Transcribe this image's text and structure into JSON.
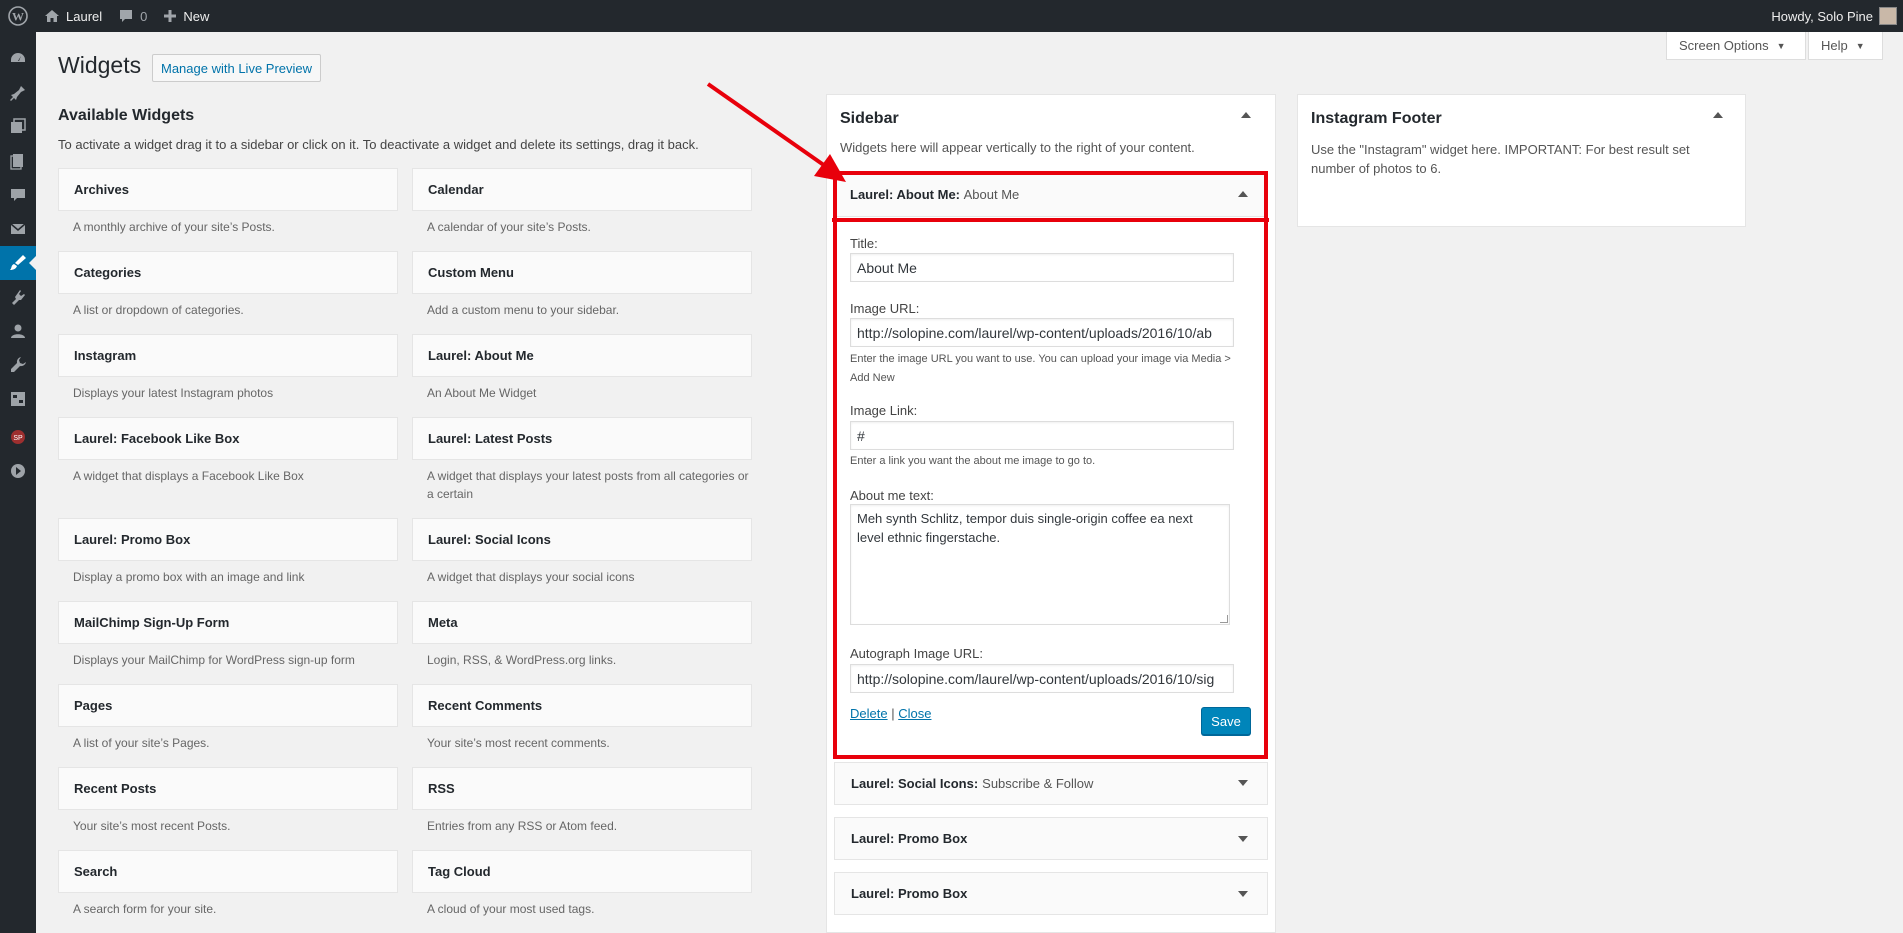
{
  "adminbar": {
    "site_name": "Laurel",
    "comments_count": "0",
    "new_label": "New",
    "howdy": "Howdy, Solo Pine"
  },
  "header": {
    "title": "Widgets",
    "live_preview": "Manage with Live Preview",
    "screen_options": "Screen Options",
    "help": "Help"
  },
  "available": {
    "title": "Available Widgets",
    "description": "To activate a widget drag it to a sidebar or click on it. To deactivate a widget and delete its settings, drag it back.",
    "widgets": [
      {
        "name": "Archives",
        "desc": "A monthly archive of your site’s Posts."
      },
      {
        "name": "Calendar",
        "desc": "A calendar of your site’s Posts."
      },
      {
        "name": "Categories",
        "desc": "A list or dropdown of categories."
      },
      {
        "name": "Custom Menu",
        "desc": "Add a custom menu to your sidebar."
      },
      {
        "name": "Instagram",
        "desc": "Displays your latest Instagram photos"
      },
      {
        "name": "Laurel: About Me",
        "desc": "An About Me Widget"
      },
      {
        "name": "Laurel: Facebook Like Box",
        "desc": "A widget that displays a Facebook Like Box"
      },
      {
        "name": "Laurel: Latest Posts",
        "desc": "A widget that displays your latest posts from all categories or a certain"
      },
      {
        "name": "Laurel: Promo Box",
        "desc": "Display a promo box with an image and link"
      },
      {
        "name": "Laurel: Social Icons",
        "desc": "A widget that displays your social icons"
      },
      {
        "name": "MailChimp Sign-Up Form",
        "desc": "Displays your MailChimp for WordPress sign-up form"
      },
      {
        "name": "Meta",
        "desc": "Login, RSS, & WordPress.org links."
      },
      {
        "name": "Pages",
        "desc": "A list of your site’s Pages."
      },
      {
        "name": "Recent Comments",
        "desc": "Your site’s most recent comments."
      },
      {
        "name": "Recent Posts",
        "desc": "Your site’s most recent Posts."
      },
      {
        "name": "RSS",
        "desc": "Entries from any RSS or Atom feed."
      },
      {
        "name": "Search",
        "desc": "A search form for your site."
      },
      {
        "name": "Tag Cloud",
        "desc": "A cloud of your most used tags."
      }
    ]
  },
  "sidebar": {
    "title": "Sidebar",
    "description": "Widgets here will appear vertically to the right of your content.",
    "open_widget": {
      "type": "Laurel: About Me:",
      "instance": "About Me",
      "title_label": "Title:",
      "title_value": "About Me",
      "image_url_label": "Image URL:",
      "image_url_value": "http://solopine.com/laurel/wp-content/uploads/2016/10/ab",
      "image_url_help": "Enter the image URL you want to use. You can upload your image via Media > Add New",
      "image_link_label": "Image Link:",
      "image_link_value": "#",
      "image_link_help": "Enter a link you want the about me image to go to.",
      "about_label": "About me text:",
      "about_value": "Meh synth Schlitz, tempor duis single-origin coffee ea next level ethnic fingerstache.",
      "autograph_label": "Autograph Image URL:",
      "autograph_value": "http://solopine.com/laurel/wp-content/uploads/2016/10/sig",
      "delete": "Delete",
      "separator": "|",
      "close": "Close",
      "save": "Save"
    },
    "collapsed": [
      {
        "type": "Laurel: Social Icons:",
        "instance": "Subscribe & Follow"
      },
      {
        "type": "Laurel: Promo Box",
        "instance": ""
      },
      {
        "type": "Laurel: Promo Box",
        "instance": ""
      }
    ]
  },
  "instagram_footer": {
    "title": "Instagram Footer",
    "description": "Use the \"Instagram\" widget here. IMPORTANT: For best result set number of photos to 6."
  },
  "colors": {
    "accent": "#0073aa",
    "annotation_red": "#e8000b",
    "adminbar_bg": "#23282d"
  }
}
